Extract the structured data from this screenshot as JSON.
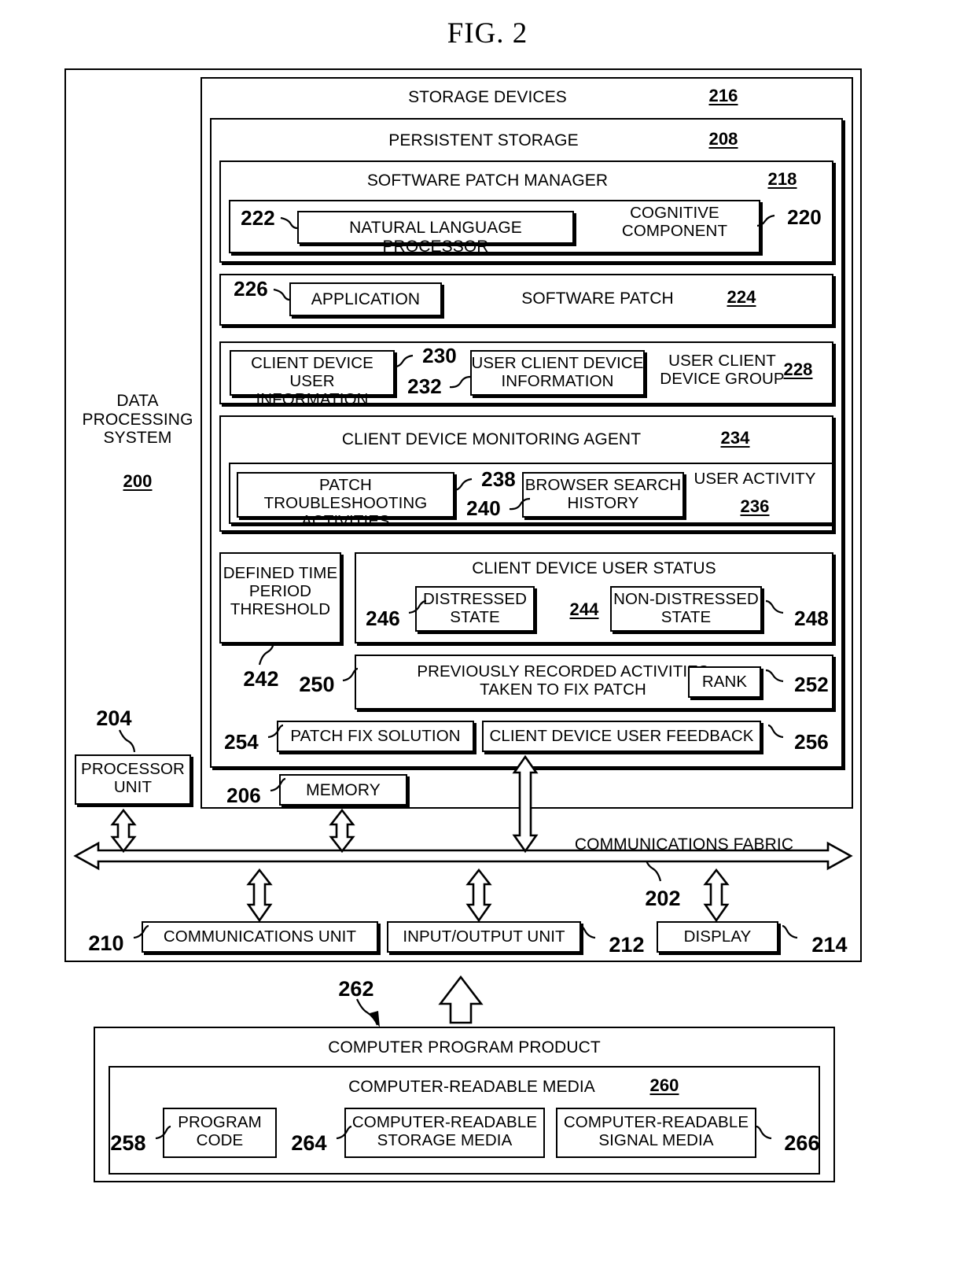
{
  "figure": {
    "title": "FIG. 2",
    "system_label": "DATA\nPROCESSING\nSYSTEM",
    "system_ref": "200"
  },
  "blocks": {
    "storage_devices": {
      "label": "STORAGE DEVICES",
      "ref": "216"
    },
    "persistent_storage": {
      "label": "PERSISTENT STORAGE",
      "ref": "208"
    },
    "software_patch_manager": {
      "label": "SOFTWARE PATCH MANAGER",
      "ref": "218"
    },
    "cognitive_component": {
      "label": "COGNITIVE\nCOMPONENT",
      "ref": "220"
    },
    "natural_language_processor": {
      "label": "NATURAL LANGUAGE PROCESSOR",
      "ref": "222"
    },
    "software_patch": {
      "label": "SOFTWARE PATCH",
      "ref": "224"
    },
    "application": {
      "label": "APPLICATION",
      "ref": "226"
    },
    "user_client_device_group": {
      "label": "USER CLIENT\nDEVICE GROUP",
      "ref": "228"
    },
    "client_device_user_information": {
      "label": "CLIENT DEVICE USER\nINFORMATION",
      "ref": "230"
    },
    "user_client_device_information": {
      "label": "USER CLIENT DEVICE\nINFORMATION",
      "ref": "232"
    },
    "client_device_monitoring_agent": {
      "label": "CLIENT DEVICE MONITORING AGENT",
      "ref": "234"
    },
    "user_activity": {
      "label": "USER ACTIVITY",
      "ref": "236"
    },
    "patch_troubleshooting_activities": {
      "label": "PATCH TROUBLESHOOTING\nACTIVITIES",
      "ref": "238"
    },
    "browser_search_history": {
      "label": "BROWSER SEARCH\nHISTORY",
      "ref": "240"
    },
    "defined_time_period_threshold": {
      "label": "DEFINED TIME\nPERIOD\nTHRESHOLD",
      "ref": "242"
    },
    "client_device_user_status": {
      "label": "CLIENT DEVICE USER STATUS",
      "ref": "244"
    },
    "distressed_state": {
      "label": "DISTRESSED\nSTATE",
      "ref": "246"
    },
    "non_distressed_state": {
      "label": "NON-DISTRESSED\nSTATE",
      "ref": "248"
    },
    "previously_recorded_activities": {
      "label": "PREVIOUSLY RECORDED ACTIVITIES\nTAKEN TO FIX PATCH",
      "ref": "250"
    },
    "rank": {
      "label": "RANK",
      "ref": "252"
    },
    "patch_fix_solution": {
      "label": "PATCH FIX SOLUTION",
      "ref": "254"
    },
    "client_device_user_feedback": {
      "label": "CLIENT DEVICE USER FEEDBACK",
      "ref": "256"
    },
    "memory": {
      "label": "MEMORY",
      "ref": "206"
    },
    "processor_unit": {
      "label": "PROCESSOR\nUNIT",
      "ref": "204"
    },
    "communications_fabric": {
      "label": "COMMUNICATIONS FABRIC",
      "ref": "202"
    },
    "communications_unit": {
      "label": "COMMUNICATIONS UNIT",
      "ref": "210"
    },
    "input_output_unit": {
      "label": "INPUT/OUTPUT UNIT",
      "ref": "212"
    },
    "display": {
      "label": "DISPLAY",
      "ref": "214"
    },
    "computer_program_product": {
      "label": "COMPUTER PROGRAM PRODUCT",
      "ref": "262"
    },
    "computer_readable_media": {
      "label": "COMPUTER-READABLE MEDIA",
      "ref": "260"
    },
    "program_code": {
      "label": "PROGRAM\nCODE",
      "ref": "258"
    },
    "computer_readable_storage_media": {
      "label": "COMPUTER-READABLE\nSTORAGE MEDIA",
      "ref": "264"
    },
    "computer_readable_signal_media": {
      "label": "COMPUTER-READABLE\nSIGNAL MEDIA",
      "ref": "266"
    }
  }
}
